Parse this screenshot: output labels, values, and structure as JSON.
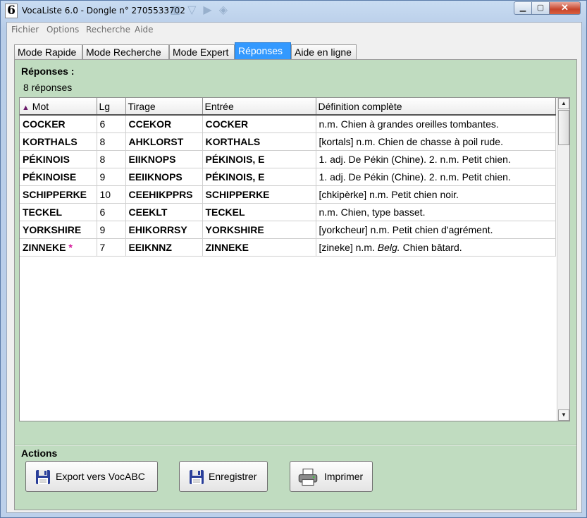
{
  "window": {
    "title": "VocaListe 6.0 - Dongle n° 2705533702",
    "app_icon_glyph": "6"
  },
  "menu": [
    "Fichier",
    "Options",
    "Recherche",
    "Aide"
  ],
  "tabs": [
    "Mode Rapide",
    "Mode Recherche",
    "Mode Expert",
    "Réponses",
    "Aide en ligne"
  ],
  "active_tab": "Réponses",
  "reponses": {
    "title": "Réponses :",
    "count_label": "8 réponses",
    "columns": [
      "Mot",
      "Lg",
      "Tirage",
      "Entrée",
      "Définition complète"
    ],
    "sort": {
      "column": "Mot",
      "direction": "ascending"
    },
    "rows": [
      {
        "mot": "COCKER",
        "lg": "6",
        "tirage": "CCEKOR",
        "entree": "COCKER",
        "def": "n.m. Chien à grandes oreilles tombantes."
      },
      {
        "mot": "KORTHALS",
        "lg": "8",
        "tirage": "AHKLORST",
        "entree": "KORTHALS",
        "def": "[kortals] n.m. Chien de chasse à poil rude."
      },
      {
        "mot": "PÉKINOIS",
        "lg": "8",
        "tirage": "EIIKNOPS",
        "entree": "PÉKINOIS, E",
        "def": "1. adj. De Pékin (Chine). 2. n.m. Petit chien."
      },
      {
        "mot": "PÉKINOISE",
        "lg": "9",
        "tirage": "EEIIKNOPS",
        "entree": "PÉKINOIS, E",
        "def": "1. adj. De Pékin (Chine). 2. n.m. Petit chien."
      },
      {
        "mot": "SCHIPPERKE",
        "lg": "10",
        "tirage": "CEEHIKPPRS",
        "entree": "SCHIPPERKE",
        "def": "[chkipèrke] n.m. Petit chien noir."
      },
      {
        "mot": "TECKEL",
        "lg": "6",
        "tirage": "CEEKLT",
        "entree": "TECKEL",
        "def": "n.m. Chien, type basset."
      },
      {
        "mot": "YORKSHIRE",
        "lg": "9",
        "tirage": "EHIKORRSY",
        "entree": "YORKSHIRE",
        "def": "[yorkcheur] n.m. Petit chien d'agrément."
      },
      {
        "mot": "ZINNEKE",
        "mot_marker": "*",
        "lg": "7",
        "tirage": "EEIKNNZ",
        "entree": "ZINNEKE",
        "def": "[zineke] n.m.",
        "def_italic": "Belg.",
        "def_tail": "Chien bâtard."
      }
    ]
  },
  "actions": {
    "title": "Actions",
    "buttons": [
      {
        "label": "Export vers VocABC",
        "icon": "floppy-disk-icon"
      },
      {
        "label": "Enregistrer",
        "icon": "floppy-disk-icon"
      },
      {
        "label": "Imprimer",
        "icon": "printer-icon"
      }
    ]
  },
  "colors": {
    "panel_bg": "#c0dcc0",
    "active_tab": "#3399ff",
    "marker_star": "#d4179a",
    "sort_arrow": "#6a1a6a"
  }
}
